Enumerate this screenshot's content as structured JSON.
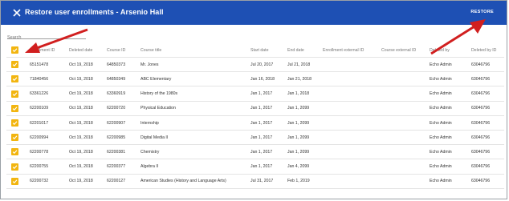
{
  "header": {
    "title": "Restore user enrollments - Arsenio Hall",
    "restore_label": "RESTORE"
  },
  "search": {
    "placeholder": "Search"
  },
  "colors": {
    "header_bg": "#1e50b4",
    "checkbox": "#f2b50f",
    "arrow": "#d11f1f"
  },
  "columns": [
    "Enrollment ID",
    "Deleted date",
    "Course ID",
    "Course title",
    "Start date",
    "End date",
    "Enrollment external ID",
    "Course external ID",
    "Deleted by",
    "Deleted by ID"
  ],
  "rows": [
    [
      "65151478",
      "Oct 19, 2018",
      "64850373",
      "Mr. Jones",
      "Jul 20, 2017",
      "Jul 21, 2018",
      "",
      "",
      "Echo Admin",
      "63046796"
    ],
    [
      "71840456",
      "Oct 19, 2018",
      "64850349",
      "ABC Elementary",
      "Jan 16, 2018",
      "Jan 21, 2018",
      "",
      "",
      "Echo Admin",
      "63046796"
    ],
    [
      "63361226",
      "Oct 19, 2018",
      "63360919",
      "History of the 1980s",
      "Jan 1, 2017",
      "Jan 1, 2018",
      "",
      "",
      "Echo Admin",
      "63046796"
    ],
    [
      "62200109",
      "Oct 19, 2018",
      "62200720",
      "Physical Education",
      "Jan 1, 2017",
      "Jan 1, 2099",
      "",
      "",
      "Echo Admin",
      "63046796"
    ],
    [
      "62201017",
      "Oct 19, 2018",
      "62200907",
      "Internship",
      "Jan 1, 2017",
      "Jan 1, 2099",
      "",
      "",
      "Echo Admin",
      "63046796"
    ],
    [
      "62200994",
      "Oct 19, 2018",
      "62200985",
      "Digital Media II",
      "Jan 1, 2017",
      "Jan 1, 2099",
      "",
      "",
      "Echo Admin",
      "63046796"
    ],
    [
      "62200778",
      "Oct 19, 2018",
      "62200381",
      "Chemistry",
      "Jan 1, 2017",
      "Jan 1, 2099",
      "",
      "",
      "Echo Admin",
      "63046796"
    ],
    [
      "62200755",
      "Oct 19, 2018",
      "62200377",
      "Algebra II",
      "Jan 1, 2017",
      "Jan 4, 2099",
      "",
      "",
      "Echo Admin",
      "63046796"
    ],
    [
      "62200732",
      "Oct 19, 2018",
      "62200127",
      "American Studies (History and Language Arts)",
      "Jul 31, 2017",
      "Feb 1, 2019",
      "",
      "",
      "Echo Admin",
      "63046796"
    ]
  ]
}
